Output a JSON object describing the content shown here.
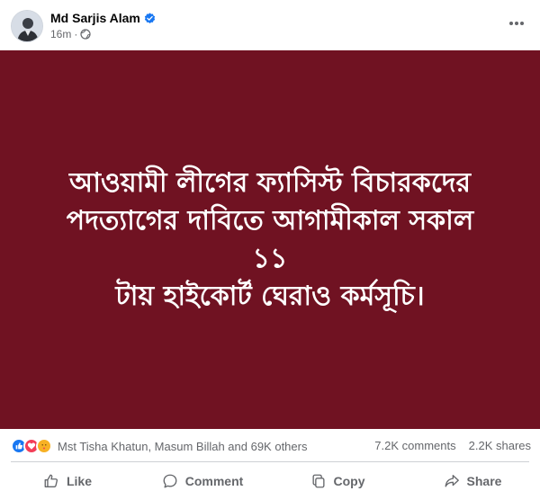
{
  "post": {
    "author": "Md Sarjis Alam",
    "time": "16m",
    "separator": "·",
    "audience_icon": "globe-icon",
    "verified_icon": "verified-badge-icon",
    "more_icon": "more-options-icon",
    "image_text_lines": [
      "আওয়ামী লীগের ফ্যাসিস্ট বিচারকদের",
      "পদত্যাগের দাবিতে আগামীকাল সকাল ১১",
      "টায় হাইকোর্ট ঘেরাও কর্মসূচি।"
    ],
    "image_background": "#701222"
  },
  "stats": {
    "reaction_icons": [
      "like-icon",
      "love-icon",
      "care-icon"
    ],
    "reactors": "Mst Tisha Khatun, Masum Billah and 69K others",
    "comments": "7.2K comments",
    "shares": "2.2K shares"
  },
  "actions": {
    "like": "Like",
    "comment": "Comment",
    "copy": "Copy",
    "share": "Share"
  },
  "colors": {
    "accent": "#1877f2",
    "secondary_text": "#65676b"
  }
}
